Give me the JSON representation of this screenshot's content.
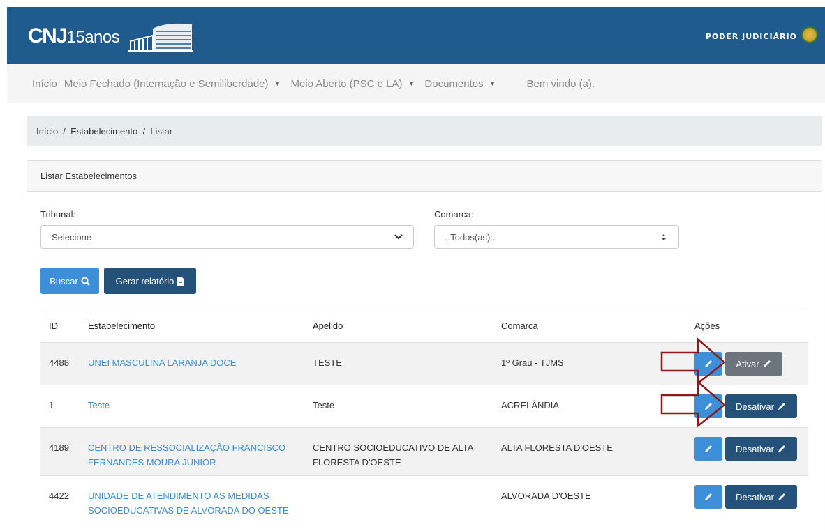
{
  "header": {
    "logo_text_bold": "CNJ",
    "logo_text_thin": "15anos",
    "poder_label": "PODER JUDICIÁRIO"
  },
  "nav": {
    "items": [
      {
        "label": "Início",
        "dropdown": false
      },
      {
        "label": "Meio Fechado (Internação e Semiliberdade)",
        "dropdown": true
      },
      {
        "label": "Meio Aberto (PSC e LA)",
        "dropdown": true
      },
      {
        "label": "Documentos",
        "dropdown": true
      }
    ],
    "welcome": "Bem vindo (a)."
  },
  "breadcrumb": [
    "Início",
    "Estabelecimento",
    "Listar"
  ],
  "card": {
    "title": "Listar Estabelecimentos"
  },
  "filters": {
    "tribunal_label": "Tribunal:",
    "tribunal_value": "Selecione",
    "comarca_label": "Comarca:",
    "comarca_value": "..Todos(as):."
  },
  "buttons": {
    "buscar": "Buscar",
    "gerar_relatorio": "Gerar relatório"
  },
  "table": {
    "headers": [
      "ID",
      "Estabelecimento",
      "Apelido",
      "Comarca",
      "Ações"
    ],
    "rows": [
      {
        "id": "4488",
        "estabelecimento": "UNEI MASCULINA LARANJA DOCE",
        "apelido": "TESTE",
        "comarca": "1º Grau - TJMS",
        "status_action": "Ativar"
      },
      {
        "id": "1",
        "estabelecimento": "Teste",
        "apelido": "Teste",
        "comarca": "ACRELÂNDIA",
        "status_action": "Desativar"
      },
      {
        "id": "4189",
        "estabelecimento": "CENTRO DE RESSOCIALIZAÇÃO FRANCISCO FERNANDES MOURA JUNIOR",
        "apelido": "CENTRO SOCIOEDUCATIVO DE ALTA FLORESTA D'OESTE",
        "comarca": "ALTA FLORESTA D'OESTE",
        "status_action": "Desativar"
      },
      {
        "id": "4422",
        "estabelecimento": "UNIDADE DE ATENDIMENTO AS MEDIDAS SOCIOEDUCATIVAS DE ALVORADA DO OESTE",
        "apelido": "",
        "comarca": "ALVORADA D'OESTE",
        "status_action": "Desativar"
      }
    ]
  },
  "colors": {
    "header_bg": "#1f5b8c",
    "primary": "#3c8fd8",
    "dark": "#24527a",
    "gray": "#6c757d",
    "link": "#3b8dd4",
    "annotation_arrow": "#8b1a1a"
  }
}
